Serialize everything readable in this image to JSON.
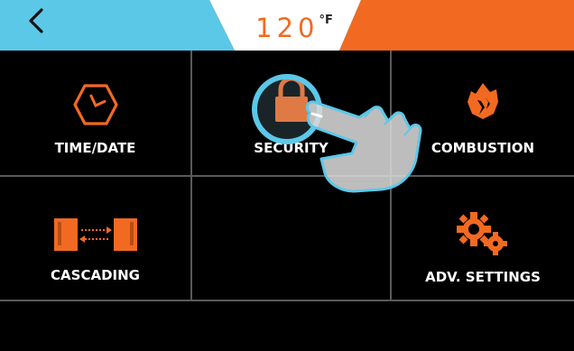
{
  "header": {
    "back_icon": "chevron-left-icon",
    "temperature_value": "120",
    "temperature_unit": "°F",
    "colors": {
      "left_band": "#5bc8e8",
      "right_band": "#f26a21",
      "center_tab": "#ffffff"
    }
  },
  "menu": {
    "tiles": [
      {
        "label": "TIME/DATE",
        "icon": "clock-icon"
      },
      {
        "label": "SECURITY",
        "icon": "padlock-icon"
      },
      {
        "label": "COMBUSTION",
        "icon": "flame-icon"
      },
      {
        "label": "CASCADING",
        "icon": "cascade-boilers-icon"
      },
      {
        "label": "",
        "icon": ""
      },
      {
        "label": "ADV. SETTINGS",
        "icon": "gears-icon"
      }
    ]
  },
  "overlay": {
    "icon": "tap-hand-icon"
  },
  "colors": {
    "accent": "#f26a21",
    "highlight_ring": "#5bc8e8",
    "grid_line": "#5a5a5a",
    "background": "#000000"
  }
}
